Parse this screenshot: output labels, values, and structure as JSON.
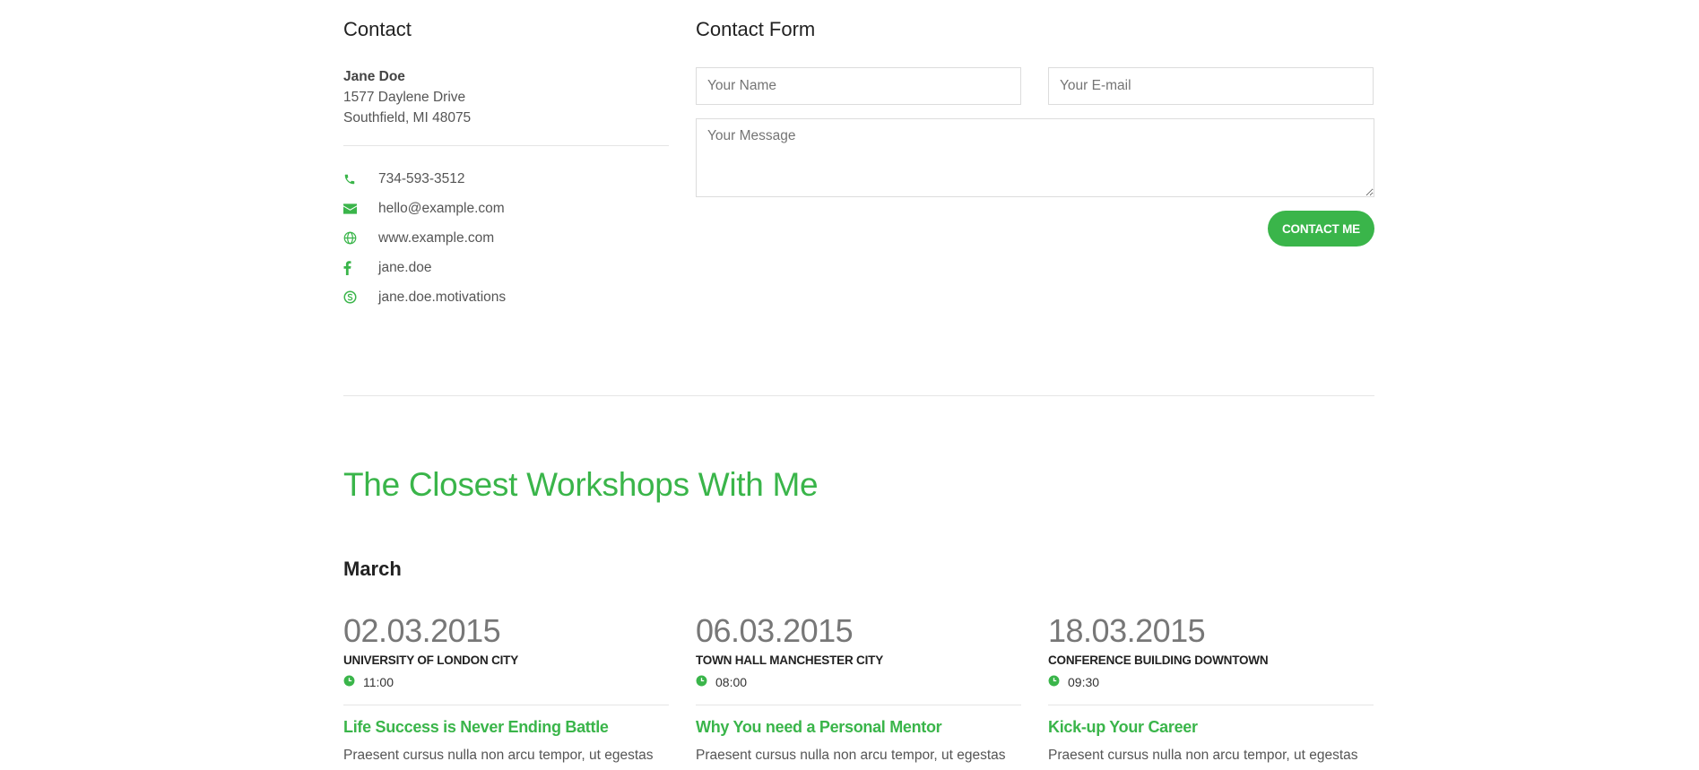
{
  "contact": {
    "heading": "Contact",
    "name": "Jane Doe",
    "address_line1": "1577 Daylene Drive",
    "address_line2": "Southfield, MI 48075",
    "items": [
      {
        "icon": "phone-icon",
        "text": "734-593-3512"
      },
      {
        "icon": "mail-icon",
        "text": "hello@example.com"
      },
      {
        "icon": "globe-icon",
        "text": "www.example.com"
      },
      {
        "icon": "facebook-icon",
        "text": "jane.doe"
      },
      {
        "icon": "skype-icon",
        "text": "jane.doe.motivations"
      }
    ]
  },
  "form": {
    "heading": "Contact Form",
    "name_placeholder": "Your Name",
    "email_placeholder": "Your E-mail",
    "message_placeholder": "Your Message",
    "submit_label": "CONTACT ME"
  },
  "workshops": {
    "title": "The Closest Workshops With Me",
    "month": "March",
    "events": [
      {
        "date": "02.03.2015",
        "venue": "UNIVERSITY OF LONDON CITY",
        "time": "11:00",
        "title": "Life Success is Never Ending Battle",
        "desc": "Praesent cursus nulla non arcu tempor, ut egestas"
      },
      {
        "date": "06.03.2015",
        "venue": "TOWN HALL MANCHESTER CITY",
        "time": "08:00",
        "title": "Why You need a Personal Mentor",
        "desc": "Praesent cursus nulla non arcu tempor, ut egestas"
      },
      {
        "date": "18.03.2015",
        "venue": "CONFERENCE BUILDING DOWNTOWN",
        "time": "09:30",
        "title": "Kick-up Your Career",
        "desc": "Praesent cursus nulla non arcu tempor, ut egestas"
      }
    ]
  },
  "colors": {
    "accent": "#3ab54a",
    "text": "#555555",
    "heading": "#222222"
  }
}
